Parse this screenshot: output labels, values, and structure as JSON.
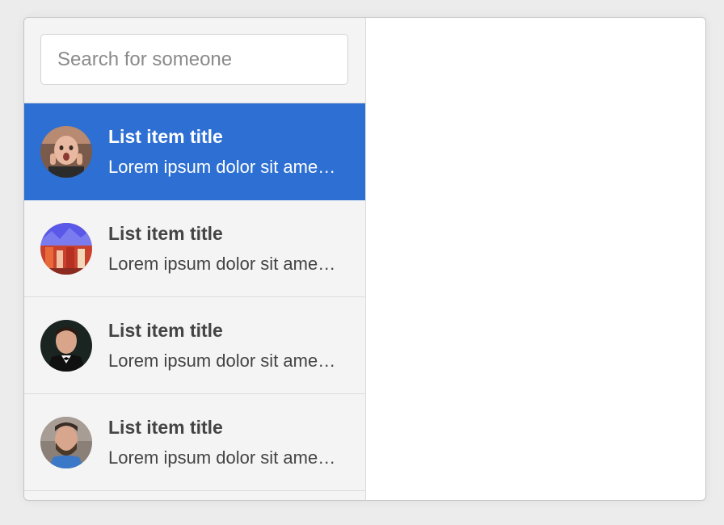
{
  "search": {
    "placeholder": "Search for someone",
    "value": ""
  },
  "list": {
    "items": [
      {
        "title": "List item title",
        "subtitle": "Lorem ipsum dolor sit amet, consectetur",
        "active": true,
        "avatar": "avatar-person-surprised"
      },
      {
        "title": "List item title",
        "subtitle": "Lorem ipsum dolor sit amet, consectetur",
        "active": false,
        "avatar": "avatar-colorful-crowd"
      },
      {
        "title": "List item title",
        "subtitle": "Lorem ipsum dolor sit amet, consectetur",
        "active": false,
        "avatar": "avatar-man-tuxedo"
      },
      {
        "title": "List item title",
        "subtitle": "Lorem ipsum dolor sit amet, consectetur",
        "active": false,
        "avatar": "avatar-bearded-man"
      }
    ]
  },
  "colors": {
    "accent": "#2d6fd3",
    "sidebar_bg": "#f4f4f4",
    "text": "#444444"
  }
}
